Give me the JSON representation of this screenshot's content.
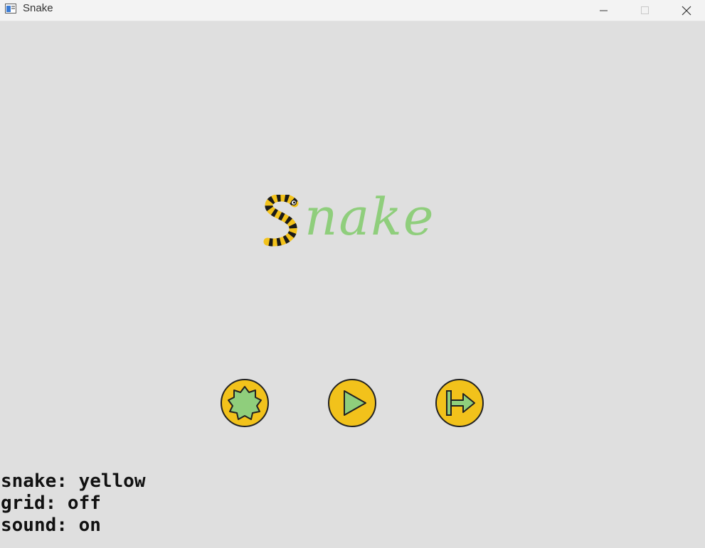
{
  "window": {
    "title": "Snake",
    "controls": [
      "minimize",
      "maximize",
      "close"
    ]
  },
  "logo": {
    "text_rest": "nake",
    "first_letter": "S",
    "text_color": "#8fce7c",
    "snake_colors": [
      "#f2c21b",
      "#1a1a1a"
    ]
  },
  "buttons": [
    {
      "id": "settings",
      "icon": "gear-icon"
    },
    {
      "id": "play",
      "icon": "play-icon"
    },
    {
      "id": "exit",
      "icon": "exit-icon"
    }
  ],
  "button_colors": {
    "fill": "#f2c21b",
    "icon_fill": "#8fce7c",
    "outline": "#222222"
  },
  "status": {
    "snake_line": "snake: yellow",
    "grid_line": "grid: off",
    "sound_line": "sound: on"
  }
}
